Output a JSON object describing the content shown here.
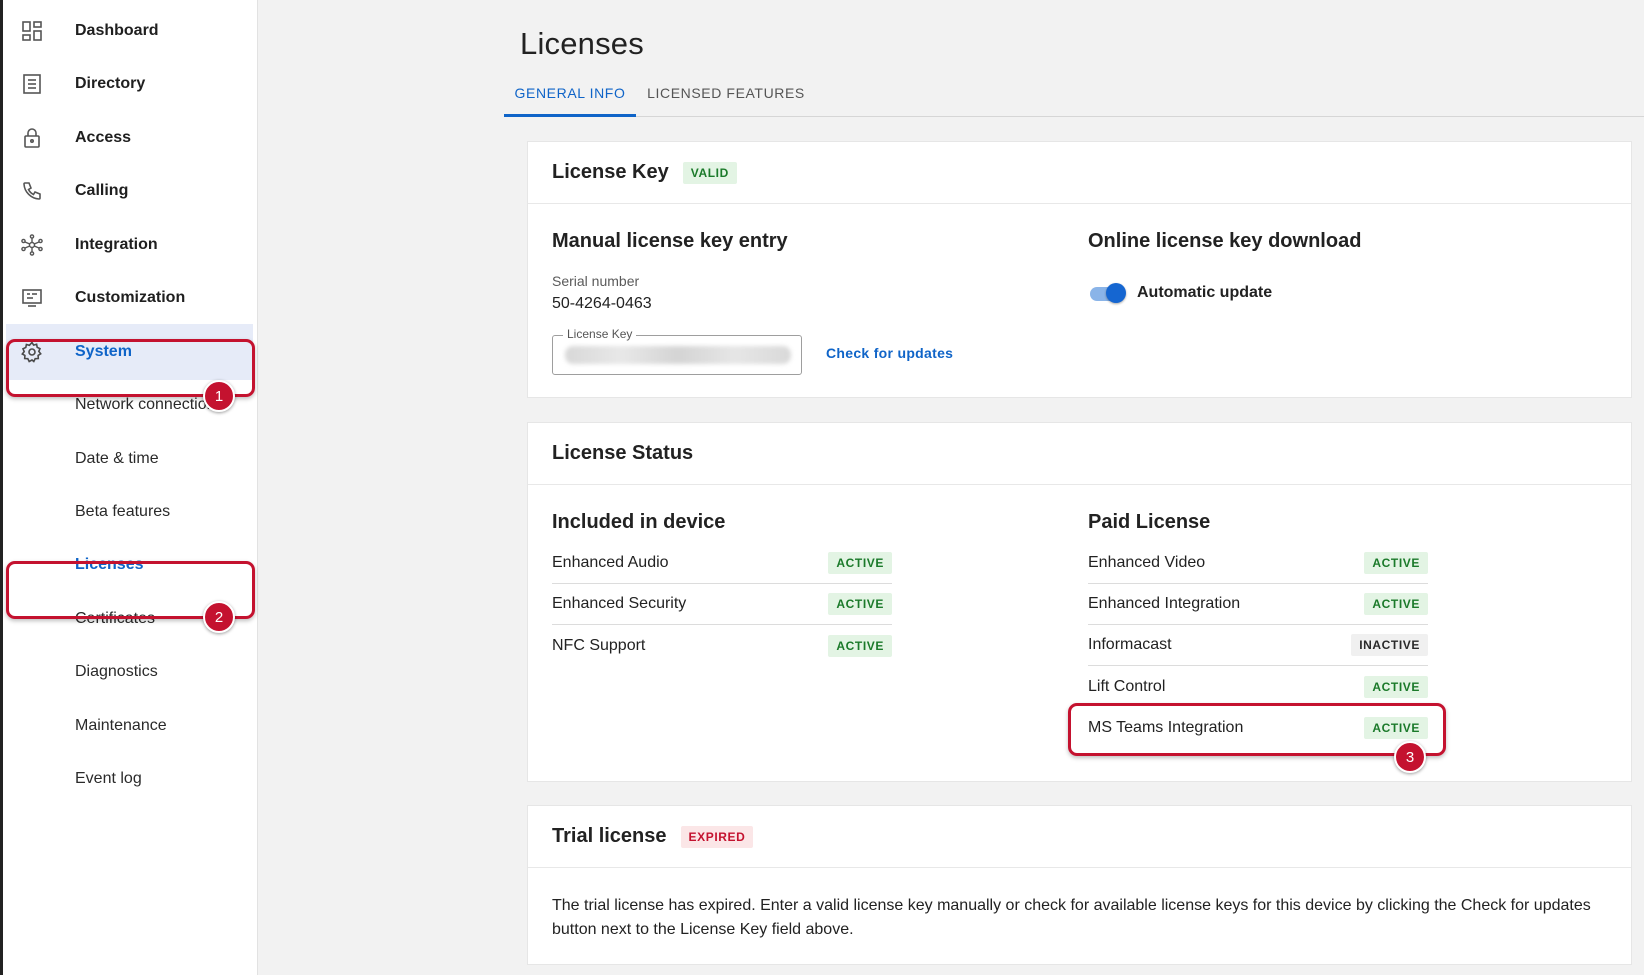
{
  "sidebar": {
    "items": [
      {
        "label": "Dashboard",
        "icon": "dashboard-icon"
      },
      {
        "label": "Directory",
        "icon": "directory-icon"
      },
      {
        "label": "Access",
        "icon": "lock-icon"
      },
      {
        "label": "Calling",
        "icon": "phone-icon"
      },
      {
        "label": "Integration",
        "icon": "integration-icon"
      },
      {
        "label": "Customization",
        "icon": "monitor-icon"
      },
      {
        "label": "System",
        "icon": "gear-icon"
      }
    ],
    "sub_items": [
      "Network connection",
      "Date & time",
      "Beta features",
      "Licenses",
      "Certificates",
      "Diagnostics",
      "Maintenance",
      "Event log"
    ]
  },
  "callouts": [
    "1",
    "2",
    "3"
  ],
  "header": {
    "title": "Licenses",
    "tabs": [
      "GENERAL INFO",
      "LICENSED FEATURES"
    ]
  },
  "license_key": {
    "title": "License Key",
    "status": "VALID",
    "manual": {
      "title": "Manual license key entry",
      "serial_label": "Serial number",
      "serial_value": "50-4264-0463",
      "field_label": "License Key",
      "check_button": "Check for updates"
    },
    "online": {
      "title": "Online license key download",
      "toggle_label": "Automatic update",
      "toggle_on": true
    }
  },
  "license_status": {
    "title": "License Status",
    "included": {
      "title": "Included in device",
      "rows": [
        {
          "name": "Enhanced Audio",
          "status": "ACTIVE"
        },
        {
          "name": "Enhanced Security",
          "status": "ACTIVE"
        },
        {
          "name": "NFC Support",
          "status": "ACTIVE"
        }
      ]
    },
    "paid": {
      "title": "Paid License",
      "rows": [
        {
          "name": "Enhanced Video",
          "status": "ACTIVE"
        },
        {
          "name": "Enhanced Integration",
          "status": "ACTIVE"
        },
        {
          "name": "Informacast",
          "status": "INACTIVE"
        },
        {
          "name": "Lift Control",
          "status": "ACTIVE"
        },
        {
          "name": "MS Teams Integration",
          "status": "ACTIVE"
        }
      ]
    }
  },
  "trial": {
    "title": "Trial license",
    "status": "EXPIRED",
    "message": "The trial license has expired. Enter a valid license key manually or check for available license keys for this device by clicking the Check for updates button next to the License Key field above."
  },
  "colors": {
    "accent": "#0f64c8",
    "active_badge_bg": "#e3f4e4",
    "active_badge_text": "#1b7a2a",
    "callout": "#c4122f"
  }
}
